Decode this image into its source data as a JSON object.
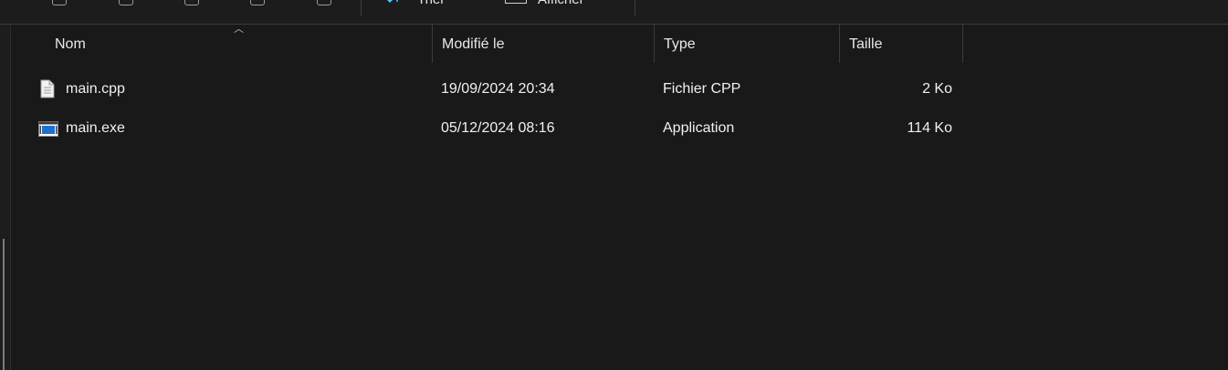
{
  "toolbar": {
    "sort_label": "Trier",
    "view_label": "Afficher"
  },
  "columns": {
    "name": "Nom",
    "modified": "Modifié le",
    "type": "Type",
    "size": "Taille"
  },
  "sort": {
    "column": "Nom",
    "direction": "ascending"
  },
  "files": [
    {
      "name": "main.cpp",
      "modified": "19/09/2024 20:34",
      "type": "Fichier CPP",
      "size": "2 Ko",
      "icon": "document-icon"
    },
    {
      "name": "main.exe",
      "modified": "05/12/2024 08:16",
      "type": "Application",
      "size": "114 Ko",
      "icon": "application-icon"
    }
  ],
  "colors": {
    "background": "#191919",
    "text": "#f0f0f0",
    "accent": "#4cc2ff"
  }
}
